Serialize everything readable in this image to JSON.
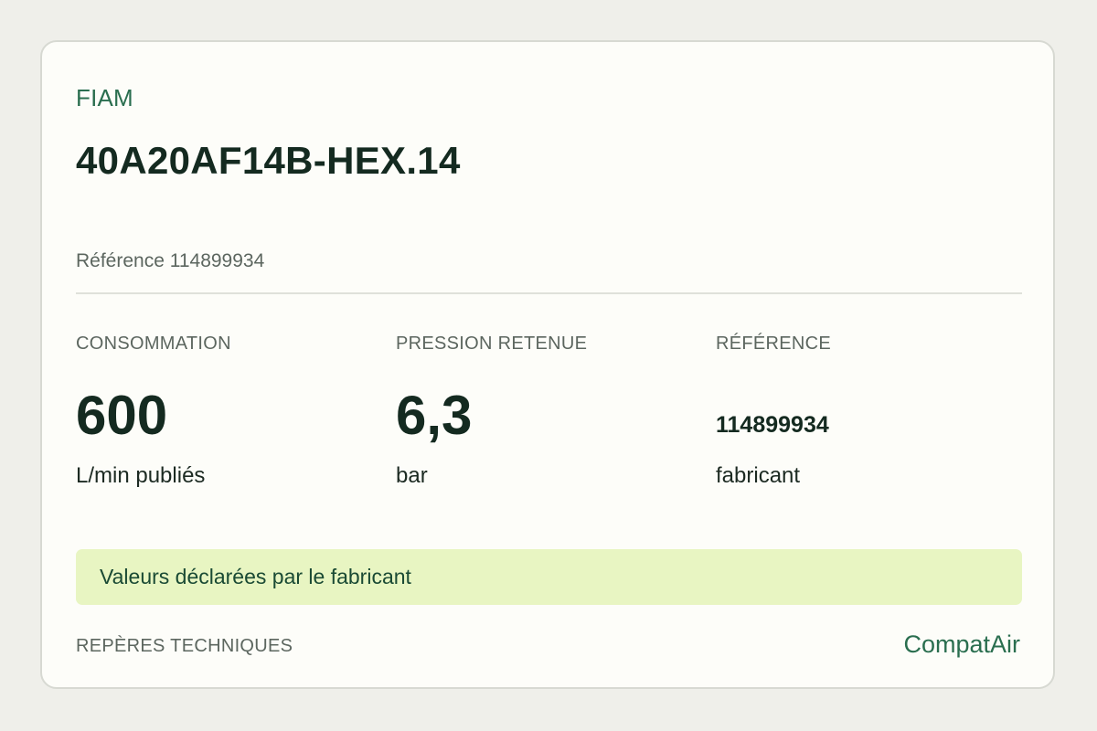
{
  "card": {
    "brand": "FIAM",
    "model": "40A20AF14B-HEX.14",
    "reference_line": "Référence 114899934",
    "metrics": [
      {
        "label": "CONSOMMATION",
        "value": "600",
        "unit": "L/min publiés"
      },
      {
        "label": "PRESSION RETENUE",
        "value": "6,3",
        "unit": "bar"
      },
      {
        "label": "RÉFÉRENCE",
        "value": "114899934",
        "unit": "fabricant"
      }
    ],
    "banner": "Valeurs déclarées par le fabricant",
    "footer": {
      "section_label": "REPÈRES TECHNIQUES",
      "site_name": "CompatAir"
    }
  },
  "colors": {
    "page_background": "#efefea",
    "card_background": "#fdfdf9",
    "accent_green": "#2a6e4f",
    "banner_background": "#e8f5c2",
    "text_dark": "#142a20",
    "text_muted": "#5c665f"
  }
}
